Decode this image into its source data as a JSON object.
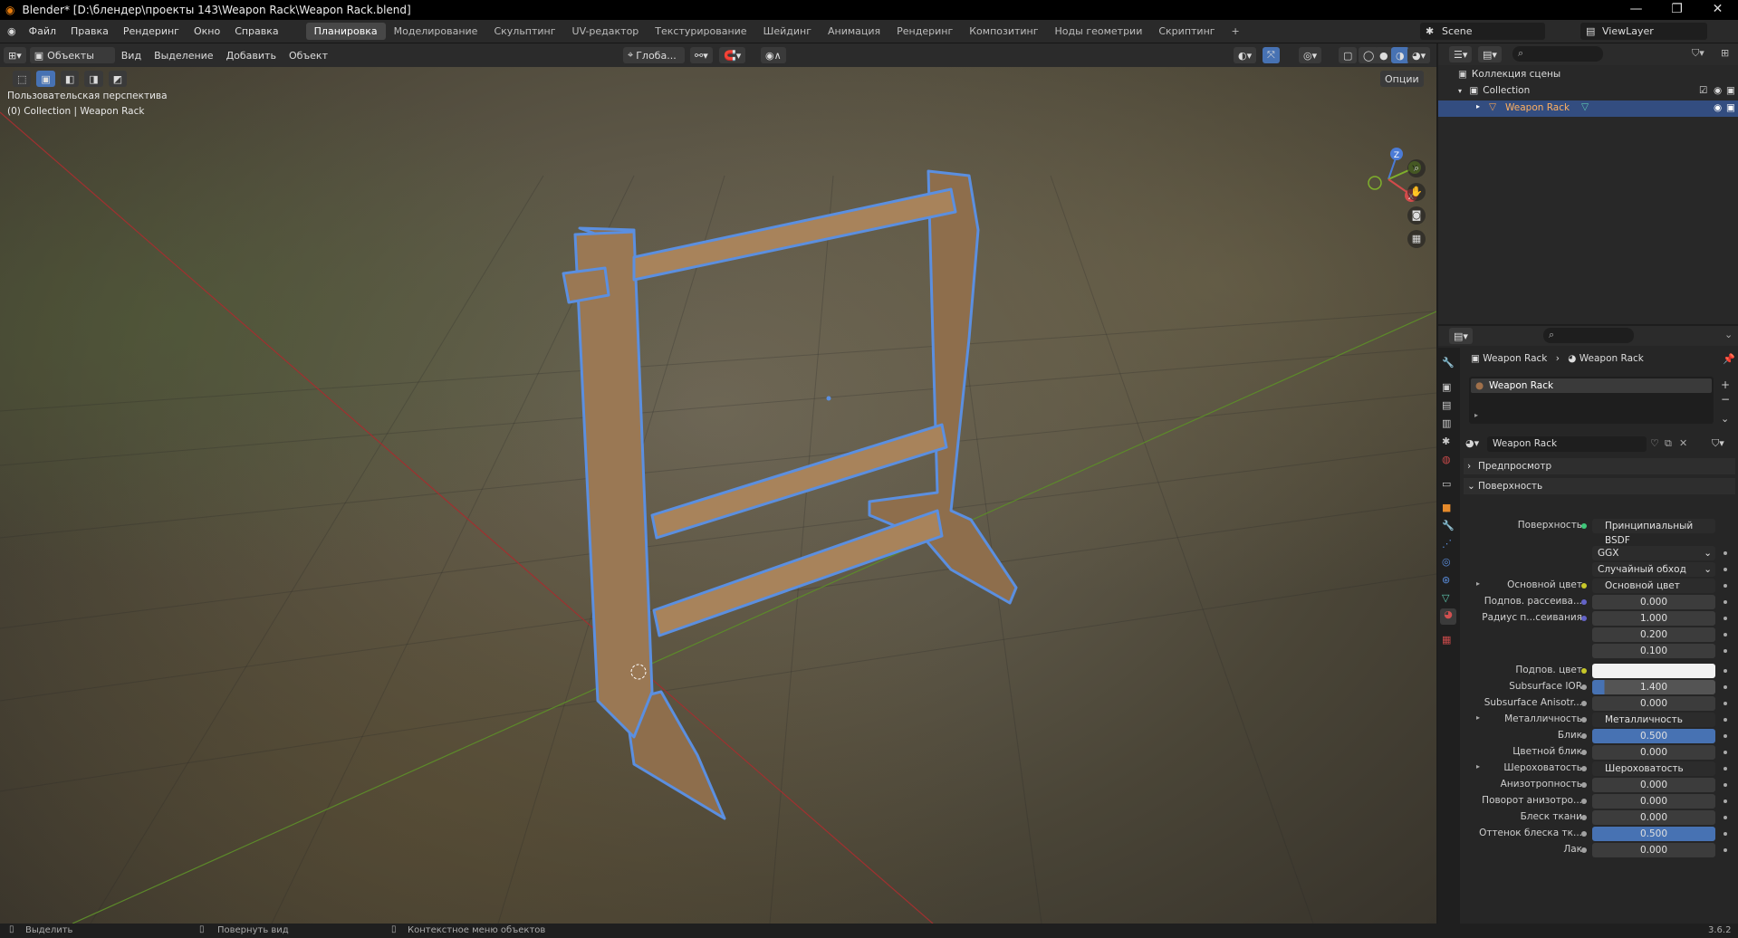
{
  "window": {
    "title": "Blender* [D:\\блендер\\проекты 143\\Weapon Rack\\Weapon Rack.blend]",
    "minimize": "—",
    "maximize": "❐",
    "close": "✕"
  },
  "menu": {
    "items": [
      "Файл",
      "Правка",
      "Рендеринг",
      "Окно",
      "Справка"
    ]
  },
  "workspaces": {
    "tabs": [
      "Планировка",
      "Моделирование",
      "Скульптинг",
      "UV-редактор",
      "Текстурирование",
      "Шейдинг",
      "Анимация",
      "Рендеринг",
      "Композитинг",
      "Ноды геометрии",
      "Скриптинг"
    ],
    "active_index": 0,
    "add": "+"
  },
  "scene": {
    "scene_name": "Scene",
    "view_layer": "ViewLayer"
  },
  "viewport_header": {
    "mode": "Объекты",
    "menus": [
      "Вид",
      "Выделение",
      "Добавить",
      "Объект"
    ],
    "orientation": "Глоба...",
    "options": "Опции"
  },
  "viewport": {
    "view_name": "Пользовательская перспектива",
    "collection_info": "(0) Collection | Weapon Rack",
    "gizmo": {
      "x": "X",
      "y": "Y",
      "z": "Z"
    }
  },
  "outliner": {
    "scene_collection": "Коллекция сцены",
    "collection": "Collection",
    "object": "Weapon Rack",
    "search_placeholder": ""
  },
  "properties": {
    "breadcrumb_object": "Weapon Rack",
    "breadcrumb_material": "Weapon Rack",
    "material_slot": "Weapon Rack",
    "material_name": "Weapon Rack",
    "preview_panel": "Предпросмотр",
    "surface_panel": "Поверхность",
    "surface_label": "Поверхность",
    "surface_shader": "Принципиальный BSDF",
    "distribution": "GGX",
    "subsurface_method": "Случайный обход",
    "rows": [
      {
        "label": "Основной цвет",
        "value": "Основной цвет",
        "kind": "link",
        "dot": "#c7c729",
        "tri": true
      },
      {
        "label": "Подпов. рассеива...",
        "value": "0.000",
        "kind": "num",
        "dot": "#6363c7"
      },
      {
        "label": "Радиус п...сеивания",
        "value": "1.000",
        "kind": "num",
        "dot": "#6363c7"
      },
      {
        "label": "",
        "value": "0.200",
        "kind": "num"
      },
      {
        "label": "",
        "value": "0.100",
        "kind": "num"
      },
      {
        "label": "Подпов. цвет",
        "value": "",
        "kind": "color",
        "dot": "#c7c729"
      },
      {
        "label": "Subsurface IOR",
        "value": "1.400",
        "kind": "bar",
        "fill": "10%",
        "dot": "#a1a1a1"
      },
      {
        "label": "Subsurface Anisotr...",
        "value": "0.000",
        "kind": "num",
        "dot": "#a1a1a1"
      },
      {
        "label": "Металличность",
        "value": "Металличность",
        "kind": "link",
        "dot": "#a1a1a1",
        "tri": true
      },
      {
        "label": "Блик",
        "value": "0.500",
        "kind": "bar",
        "fill": "100%",
        "dot": "#a1a1a1"
      },
      {
        "label": "Цветной блик",
        "value": "0.000",
        "kind": "num",
        "dot": "#a1a1a1"
      },
      {
        "label": "Шероховатость",
        "value": "Шероховатость",
        "kind": "link",
        "dot": "#a1a1a1",
        "tri": true
      },
      {
        "label": "Анизотропность",
        "value": "0.000",
        "kind": "num",
        "dot": "#a1a1a1"
      },
      {
        "label": "Поворот анизотро...",
        "value": "0.000",
        "kind": "num",
        "dot": "#a1a1a1"
      },
      {
        "label": "Блеск ткани",
        "value": "0.000",
        "kind": "num",
        "dot": "#a1a1a1"
      },
      {
        "label": "Оттенок блеска тк...",
        "value": "0.500",
        "kind": "bar",
        "fill": "100%",
        "dot": "#a1a1a1"
      },
      {
        "label": "Лак",
        "value": "0.000",
        "kind": "num",
        "dot": "#a1a1a1"
      }
    ]
  },
  "statusbar": {
    "select": "Выделить",
    "rotate": "Повернуть вид",
    "context": "Контекстное меню объектов",
    "version": "3.6.2"
  }
}
